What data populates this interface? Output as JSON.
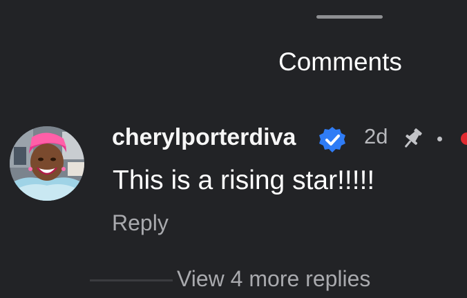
{
  "sheet": {
    "title": "Comments"
  },
  "comment": {
    "username": "cherylporterdiva",
    "verified_icon": "verified-badge-icon",
    "verified_color": "#2f7cf6",
    "time": "2d",
    "pin_icon": "pin-icon",
    "text": "This is a rising star!!!!!",
    "reply_label": "Reply",
    "more_replies_label": "View 4 more replies"
  },
  "colors": {
    "background": "#222326",
    "secondary_text": "#a9aaae",
    "notification_dot": "#e0292f"
  }
}
